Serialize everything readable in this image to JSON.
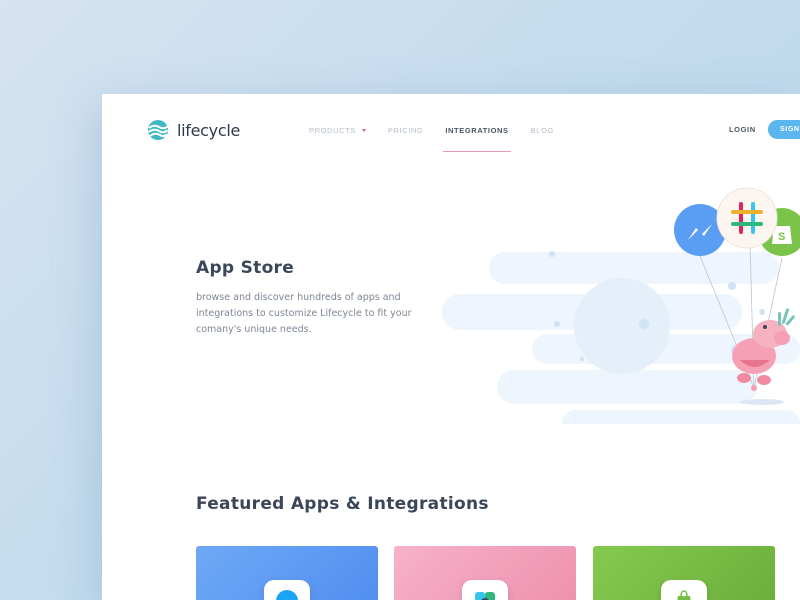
{
  "brand": {
    "name": "lifecycle",
    "accent": "#3fb7c7"
  },
  "nav": {
    "items": [
      {
        "label": "PRODUCTS",
        "has_dropdown": true,
        "active": false
      },
      {
        "label": "PRICING",
        "active": false
      },
      {
        "label": "INTEGRATIONS",
        "active": true
      },
      {
        "label": "BLOG",
        "active": false
      }
    ],
    "login_label": "LOGIN",
    "signup_label": "SIGNU"
  },
  "hero": {
    "title": "App Store",
    "description": "browse and discover hundreds of apps and integrations to customize Lifecycle to fit your comany's unique needs."
  },
  "illustration": {
    "balloons": [
      "messenger-icon",
      "slack-icon",
      "shopify-icon"
    ],
    "character": "hippo"
  },
  "featured": {
    "title": "Featured Apps & Integrations",
    "cards": [
      {
        "icon": "messenger-icon",
        "color": "#5b9af2"
      },
      {
        "icon": "slack-icon",
        "color": "#f2a2bd"
      },
      {
        "icon": "shopify-icon",
        "color": "#78bd45"
      }
    ]
  }
}
